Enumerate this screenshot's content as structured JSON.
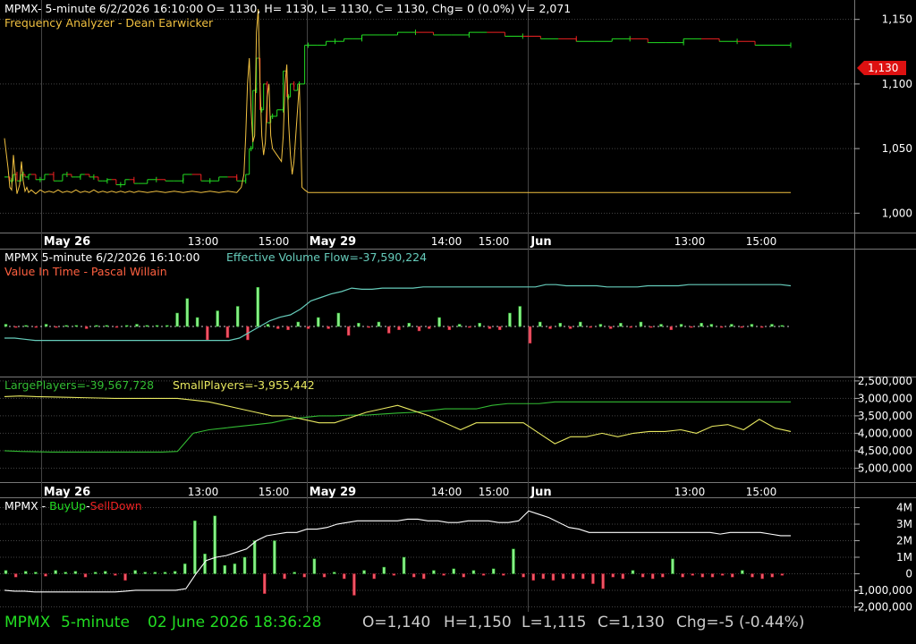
{
  "colors": {
    "bg": "#000000",
    "grid": "#555555",
    "up": "#22dd22",
    "down": "#ee2222",
    "price_line": "#f0c040",
    "flow_line": "#66ccbb",
    "large_line": "#33bb33",
    "small_line": "#e8e860",
    "white": "#ffffff",
    "badge": "#dd1111",
    "status_green": "#22dd22",
    "status_gray": "#cccccc"
  },
  "panel1": {
    "header": "MPMX- 5-minute 6/2/2026 16:10:00 O= 1130, H= 1130, L= 1130, C= 1130, Chg= 0 (0.0%) V= 2,071",
    "indicator": "Frequency Analyzer - Dean Earwicker",
    "last_price_badge": "1,130"
  },
  "panel2": {
    "header_symbol": "MPMX 5-minute  6/2/2026 16:10:00",
    "header_indicator": "Effective Volume Flow=-37,590,224",
    "indicator": "Value In Time - Pascal Willain"
  },
  "panel3": {
    "large_label": "LargePlayers=-39,567,728",
    "small_label": "SmallPlayers=-3,955,442"
  },
  "panel4": {
    "title_prefix": "MPMX - ",
    "buy_label": "BuyUp",
    "sep": "-",
    "sell_label": "SellDown"
  },
  "time_axis": {
    "labels": [
      {
        "text": "May 26",
        "bold": true
      },
      {
        "text": "13:00",
        "bold": false
      },
      {
        "text": "15:00",
        "bold": false
      },
      {
        "text": "May 29",
        "bold": true
      },
      {
        "text": "14:00",
        "bold": false
      },
      {
        "text": "15:00",
        "bold": false
      },
      {
        "text": "Jun",
        "bold": true
      },
      {
        "text": "13:00",
        "bold": false
      },
      {
        "text": "15:00",
        "bold": false
      }
    ]
  },
  "status_bar": {
    "symbol": "MPMX",
    "interval": "5-minute",
    "datetime": "02 June 2026 18:36:28",
    "open": "O=1,140",
    "high": "H=1,150",
    "low": "L=1,115",
    "close": "C=1,130",
    "change": "Chg=-5 (-0.44%)"
  },
  "chart_data": [
    {
      "type": "line",
      "name": "price",
      "y_ticks": [
        1000,
        1050,
        1100,
        1150
      ],
      "y_tick_labels": [
        "1,000",
        "1,050",
        "1,100",
        "1,150"
      ],
      "ylim": [
        985,
        1165
      ],
      "last": 1130,
      "x": [
        0,
        4,
        6,
        8,
        10,
        12,
        14,
        17,
        19,
        21,
        23,
        25,
        27,
        30,
        35,
        40,
        45,
        50,
        55,
        60,
        65,
        70,
        75,
        80,
        85,
        90,
        95,
        100,
        105,
        110,
        115,
        120,
        125,
        130,
        135,
        140,
        145,
        150,
        160,
        170,
        180,
        190,
        200,
        210,
        220,
        230,
        240,
        250,
        260,
        265,
        268,
        270,
        272,
        274,
        276,
        278,
        280,
        282,
        284,
        286,
        288,
        290,
        292,
        294,
        296,
        298,
        300,
        305,
        310,
        312,
        314,
        316,
        318,
        320,
        322,
        324,
        326,
        328,
        330,
        333,
        336,
        340,
        350,
        360,
        370,
        380,
        390,
        400,
        420,
        440,
        460,
        480,
        500,
        520,
        540,
        560,
        580,
        600,
        620,
        640,
        660,
        680,
        700,
        720,
        740,
        760,
        780,
        800,
        820,
        840,
        860,
        880
      ],
      "lines": [
        {
          "name": "Price (step)",
          "color_up": "#22dd22",
          "color_down": "#ee2222",
          "y": [
            1028,
            1028,
            1025,
            1025,
            1030,
            1030,
            1025,
            1025,
            1030,
            1030,
            1028,
            1028,
            1030,
            1030,
            1026,
            1026,
            1030,
            1030,
            1025,
            1025,
            1030,
            1030,
            1028,
            1028,
            1030,
            1030,
            1028,
            1028,
            1025,
            1025,
            1026,
            1026,
            1022,
            1022,
            1026,
            1026,
            1023,
            1023,
            1026,
            1026,
            1025,
            1025,
            1030,
            1030,
            1025,
            1025,
            1028,
            1028,
            1025,
            1025,
            1025,
            1030,
            1030,
            1050,
            1050,
            1095,
            1095,
            1120,
            1120,
            1080,
            1080,
            1100,
            1100,
            1070,
            1070,
            1075,
            1075,
            1080,
            1080,
            1110,
            1110,
            1090,
            1090,
            1100,
            1100,
            1095,
            1095,
            1100,
            1100,
            1100,
            1130,
            1130,
            1130,
            1133,
            1133,
            1135,
            1135,
            1138,
            1138,
            1140,
            1140,
            1138,
            1138,
            1140,
            1140,
            1137,
            1137,
            1135,
            1135,
            1133,
            1133,
            1135,
            1135,
            1132,
            1132,
            1135,
            1135,
            1133,
            1133,
            1130,
            1130,
            1130
          ]
        },
        {
          "name": "Frequency Analyzer",
          "color": "#f0c040",
          "y": [
            1058,
            1035,
            1020,
            1018,
            1045,
            1030,
            1015,
            1022,
            1040,
            1025,
            1017,
            1020,
            1016,
            1018,
            1015,
            1018,
            1016,
            1017,
            1016,
            1018,
            1016,
            1017,
            1016,
            1018,
            1016,
            1017,
            1016,
            1018,
            1016,
            1017,
            1016,
            1017,
            1016,
            1017,
            1016,
            1017,
            1016,
            1017,
            1016,
            1017,
            1016,
            1017,
            1016,
            1017,
            1016,
            1017,
            1016,
            1017,
            1016,
            1020,
            1030,
            1060,
            1100,
            1120,
            1080,
            1055,
            1060,
            1140,
            1158,
            1100,
            1060,
            1045,
            1055,
            1090,
            1100,
            1060,
            1050,
            1045,
            1040,
            1060,
            1100,
            1115,
            1070,
            1045,
            1030,
            1040,
            1060,
            1080,
            1100,
            1020,
            1018,
            1016,
            1016,
            1016,
            1016,
            1016,
            1016,
            1016,
            1016,
            1016,
            1016,
            1016,
            1016,
            1016,
            1016,
            1016,
            1016,
            1016,
            1016,
            1016,
            1016,
            1016,
            1016,
            1016,
            1016,
            1016,
            1016,
            1016,
            1016,
            1016,
            1016,
            1016
          ]
        }
      ]
    },
    {
      "type": "bar",
      "name": "Effective Volume Flow",
      "bars": [
        2,
        -1,
        1,
        -1,
        2,
        -1,
        1,
        1,
        -2,
        1,
        1,
        -1,
        1,
        2,
        1,
        1,
        1,
        12,
        25,
        8,
        -12,
        14,
        -10,
        18,
        -12,
        35,
        2,
        -2,
        -3,
        4,
        -2,
        8,
        -2,
        12,
        -8,
        3,
        -1,
        4,
        -6,
        -3,
        3,
        -4,
        -2,
        8,
        -3,
        2,
        -1,
        3,
        -2,
        -3,
        12,
        18,
        -15,
        4,
        -2,
        3,
        -2,
        4,
        -1,
        2,
        -2,
        3,
        -1,
        4,
        -1,
        2,
        -3,
        2,
        -1,
        3,
        2,
        -1,
        2,
        -1,
        2,
        -1,
        2,
        1
      ],
      "flow_line": [
        -10,
        -10,
        -11,
        -12,
        -12,
        -12,
        -12,
        -12,
        -12,
        -12,
        -12,
        -12,
        -12,
        -12,
        -12,
        -12,
        -12,
        -12,
        -12,
        -12,
        -12,
        -12,
        -12,
        -10,
        -5,
        0,
        5,
        8,
        10,
        15,
        22,
        25,
        28,
        30,
        33,
        32,
        32,
        33,
        33,
        33,
        33,
        34,
        34,
        34,
        34,
        34,
        34,
        34,
        34,
        34,
        34,
        34,
        34,
        36,
        36,
        35,
        35,
        35,
        35,
        34,
        34,
        34,
        34,
        35,
        35,
        35,
        35,
        36,
        36,
        36,
        36,
        36,
        36,
        36,
        36,
        36,
        36,
        35
      ]
    },
    {
      "type": "line",
      "name": "Large/Small Players",
      "y_ticks": [
        2500000,
        3000000,
        3500000,
        4000000,
        4500000,
        5000000
      ],
      "y_tick_labels": [
        "2,500,000",
        "3,000,000",
        "3,500,000",
        "4,000,000",
        "4,500,000",
        "5,000,000"
      ],
      "ylim": [
        5400000,
        2400000
      ],
      "series": [
        {
          "name": "LargePlayers",
          "color": "#33bb33",
          "values": [
            4500000,
            4520000,
            4530000,
            4540000,
            4540000,
            4540000,
            4540000,
            4540000,
            4540000,
            4540000,
            4540000,
            4520000,
            4000000,
            3900000,
            3850000,
            3800000,
            3750000,
            3700000,
            3600000,
            3550000,
            3500000,
            3500000,
            3480000,
            3480000,
            3450000,
            3420000,
            3400000,
            3350000,
            3300000,
            3300000,
            3300000,
            3200000,
            3150000,
            3150000,
            3150000,
            3100000,
            3100000,
            3100000,
            3100000,
            3100000,
            3100000,
            3100000,
            3100000,
            3100000,
            3100000,
            3100000,
            3100000,
            3100000,
            3100000,
            3100000,
            3100000
          ]
        },
        {
          "name": "SmallPlayers",
          "color": "#e8e860",
          "values": [
            2950000,
            2930000,
            2950000,
            2960000,
            2970000,
            2980000,
            2990000,
            3000000,
            3000000,
            3000000,
            3000000,
            3000000,
            3050000,
            3100000,
            3200000,
            3300000,
            3400000,
            3500000,
            3500000,
            3600000,
            3700000,
            3700000,
            3550000,
            3400000,
            3300000,
            3200000,
            3350000,
            3500000,
            3700000,
            3900000,
            3700000,
            3700000,
            3700000,
            3700000,
            4000000,
            4300000,
            4100000,
            4100000,
            4000000,
            4100000,
            4000000,
            3950000,
            3950000,
            3900000,
            4000000,
            3800000,
            3750000,
            3900000,
            3600000,
            3850000,
            3950000
          ]
        }
      ]
    },
    {
      "type": "bar",
      "name": "BuyUp-SellDown",
      "y_ticks": [
        4000000,
        3000000,
        2000000,
        1000000,
        0,
        -1000000,
        -2000000
      ],
      "y_tick_labels": [
        "4M",
        "3M",
        "2M",
        "1M",
        "0",
        "-1,000,000",
        "-2,000,000"
      ],
      "ylim": [
        -2300000,
        4300000
      ],
      "bars": [
        200000,
        -200000,
        150000,
        100000,
        -150000,
        200000,
        100000,
        150000,
        -200000,
        100000,
        150000,
        -100000,
        -400000,
        200000,
        100000,
        100000,
        100000,
        150000,
        600000,
        3200000,
        1200000,
        3500000,
        500000,
        600000,
        1000000,
        2000000,
        -1200000,
        2000000,
        -300000,
        100000,
        -200000,
        900000,
        -200000,
        100000,
        -300000,
        -1300000,
        200000,
        -300000,
        400000,
        -100000,
        1000000,
        -200000,
        -300000,
        200000,
        -100000,
        300000,
        -200000,
        200000,
        -100000,
        300000,
        -100000,
        1500000,
        -200000,
        -400000,
        -300000,
        -400000,
        -300000,
        -300000,
        -300000,
        -600000,
        -900000,
        -200000,
        -300000,
        200000,
        -200000,
        -300000,
        -200000,
        900000,
        -200000,
        -100000,
        -200000,
        -200000,
        -100000,
        -200000,
        200000,
        -200000,
        -300000,
        -200000,
        -100000
      ],
      "cumulative_line": [
        -1000000,
        -1050000,
        -1050000,
        -1100000,
        -1100000,
        -1100000,
        -1100000,
        -1100000,
        -1100000,
        -1100000,
        -1100000,
        -1100000,
        -1050000,
        -1000000,
        -1000000,
        -1000000,
        -1000000,
        -1000000,
        -900000,
        0,
        800000,
        1000000,
        1100000,
        1300000,
        1500000,
        2000000,
        2300000,
        2400000,
        2500000,
        2500000,
        2700000,
        2700000,
        2800000,
        3000000,
        3100000,
        3200000,
        3200000,
        3200000,
        3200000,
        3200000,
        3300000,
        3300000,
        3200000,
        3200000,
        3100000,
        3100000,
        3200000,
        3200000,
        3200000,
        3100000,
        3100000,
        3200000,
        3800000,
        3600000,
        3400000,
        3100000,
        2800000,
        2700000,
        2500000,
        2500000,
        2500000,
        2500000,
        2500000,
        2500000,
        2500000,
        2500000,
        2500000,
        2500000,
        2500000,
        2500000,
        2500000,
        2400000,
        2500000,
        2500000,
        2500000,
        2500000,
        2400000,
        2300000,
        2300000
      ]
    }
  ]
}
